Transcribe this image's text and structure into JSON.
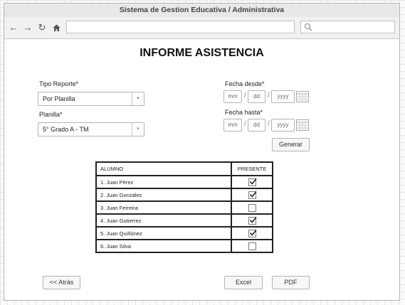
{
  "window": {
    "title": "Sistema de Gestion Educativa / Administrativa"
  },
  "page": {
    "heading": "INFORME ASISTENCIA"
  },
  "form": {
    "tipo_reporte_label": "Tipo Reporte*",
    "tipo_reporte_value": "Por Planilla",
    "planilla_label": "Planilla*",
    "planilla_value": "5° Grado A - TM",
    "fecha_desde_label": "Fecha desde*",
    "fecha_hasta_label": "Fecha hasta*",
    "date_placeholders": {
      "mm": "mm",
      "dd": "dd",
      "yyyy": "yyyy"
    },
    "date_separator": "/",
    "generar_label": "Generar"
  },
  "table": {
    "headers": [
      "ALUMNO",
      "PRESENTE"
    ],
    "rows": [
      {
        "alumno": "1. Juan Pérez",
        "presente": true
      },
      {
        "alumno": "2. Juan González",
        "presente": true
      },
      {
        "alumno": "3. Juan Ferreira",
        "presente": false
      },
      {
        "alumno": "4. Juan Gutierrez",
        "presente": true
      },
      {
        "alumno": "5. Juan Quiñónez",
        "presente": true
      },
      {
        "alumno": "6. Juan Silva",
        "presente": false
      }
    ]
  },
  "footer": {
    "back_label": "<< Atrás",
    "excel_label": "Excel",
    "pdf_label": "PDF"
  },
  "icons": {
    "back": "arrow-left-icon",
    "forward": "arrow-right-icon",
    "reload": "reload-icon",
    "home": "home-icon",
    "search": "search-icon",
    "calendar": "calendar-icon",
    "dropdown": "chevron-down-icon",
    "check": "check-icon"
  }
}
